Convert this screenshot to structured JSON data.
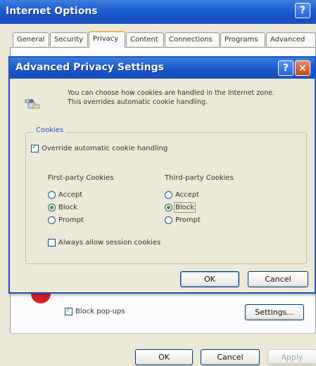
{
  "outer": {
    "title": "Internet Options",
    "help_icon": "?",
    "tabs": [
      {
        "label": "General"
      },
      {
        "label": "Security"
      },
      {
        "label": "Privacy"
      },
      {
        "label": "Content"
      },
      {
        "label": "Connections"
      },
      {
        "label": "Programs"
      },
      {
        "label": "Advanced"
      }
    ],
    "block_popups_label": "Block pop-ups",
    "settings_label": "Settings...",
    "ok_label": "OK",
    "cancel_label": "Cancel",
    "apply_label": "Apply"
  },
  "modal": {
    "title": "Advanced Privacy Settings",
    "help_icon": "?",
    "close_icon": "×",
    "info_text": "You can choose how cookies are handled in the Internet zone. This overrides automatic cookie handling.",
    "cookies_legend": "Cookies",
    "override_label": "Override automatic cookie handling",
    "first_party_label": "First-party Cookies",
    "third_party_label": "Third-party Cookies",
    "accept_label": "Accept",
    "block_label": "Block",
    "prompt_label": "Prompt",
    "session_label": "Always allow session cookies",
    "ok_label": "OK",
    "cancel_label": "Cancel"
  },
  "colors": {
    "title_bar": "#1f5fd4",
    "dialog_bg": "#ece9d8",
    "accent_green": "#21a121"
  }
}
